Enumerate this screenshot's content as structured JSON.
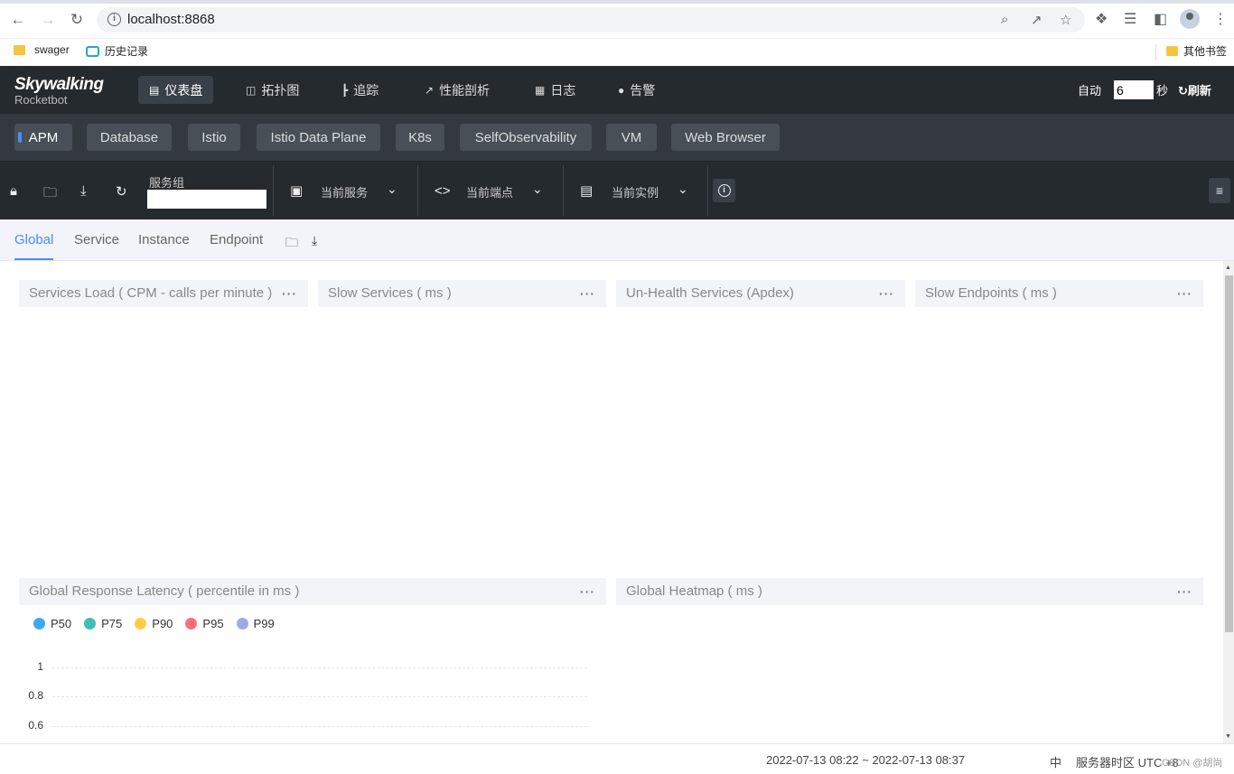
{
  "browser": {
    "url": "localhost:8868",
    "bookmarks": [
      "swager",
      "历史记录"
    ],
    "other_bookmarks": "其他书签"
  },
  "app": {
    "logo_main": "Skywalking",
    "logo_sub": "Rocketbot",
    "nav": [
      {
        "label": "仪表盘",
        "icon": "chart-icon"
      },
      {
        "label": "拓扑图",
        "icon": "topology-icon"
      },
      {
        "label": "追踪",
        "icon": "trace-icon"
      },
      {
        "label": "性能剖析",
        "icon": "profile-icon"
      },
      {
        "label": "日志",
        "icon": "log-icon"
      },
      {
        "label": "告警",
        "icon": "alarm-icon"
      }
    ],
    "auto_label": "自动",
    "refresh_value": "6",
    "seconds_label": "秒",
    "refresh_label": "刷新"
  },
  "groups": [
    "APM",
    "Database",
    "Istio",
    "Istio Data Plane",
    "K8s",
    "SelfObservability",
    "VM",
    "Web Browser"
  ],
  "toolbar": {
    "service_group_label": "服务组",
    "service_group_value": "",
    "current_service": "当前服务",
    "current_endpoint": "当前端点",
    "current_instance": "当前实例"
  },
  "tabs": [
    "Global",
    "Service",
    "Instance",
    "Endpoint"
  ],
  "panels": {
    "services_load": "Services Load ( CPM - calls per minute )",
    "slow_services": "Slow Services ( ms )",
    "unhealth_services": "Un-Health Services (Apdex)",
    "slow_endpoints": "Slow Endpoints ( ms )",
    "global_latency": "Global Response Latency ( percentile in ms )",
    "global_heatmap": "Global Heatmap ( ms )",
    "more": "···"
  },
  "chart_data": {
    "type": "line",
    "series": [
      {
        "name": "P50",
        "color": "#3fa9f5",
        "values": []
      },
      {
        "name": "P75",
        "color": "#3fbfb5",
        "values": []
      },
      {
        "name": "P90",
        "color": "#ffcc44",
        "values": []
      },
      {
        "name": "P95",
        "color": "#ff6b81",
        "values": []
      },
      {
        "name": "P99",
        "color": "#a1a8e8",
        "values": []
      }
    ],
    "y_ticks": [
      "1",
      "0.8",
      "0.6"
    ]
  },
  "footer": {
    "time_range": "2022-07-13 08:22 ~ 2022-07-13 08:37",
    "lang": "中",
    "timezone": "服务器时区 UTC +8",
    "watermark": "CSDN @胡尚"
  }
}
